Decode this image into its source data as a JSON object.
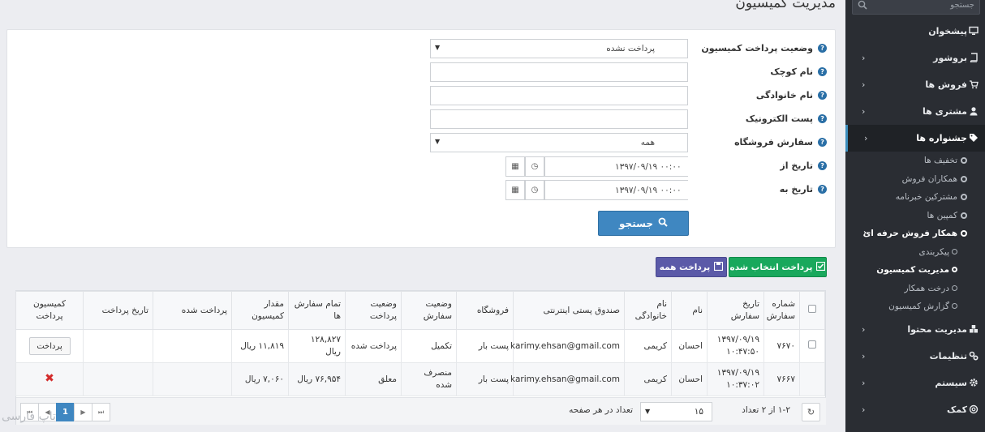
{
  "page": {
    "title": "مدیریت کمیسیون"
  },
  "sidebar": {
    "search_placeholder": "جستجو",
    "items": [
      {
        "label": "پیشخوان"
      },
      {
        "label": "بروشور"
      },
      {
        "label": "فروش ها"
      },
      {
        "label": "مشتری ها"
      },
      {
        "label": "جشنواره ها"
      }
    ],
    "festival_sub": [
      {
        "label": "تخفیف ها"
      },
      {
        "label": "همکاران فروش"
      },
      {
        "label": "مشترکین خبرنامه"
      },
      {
        "label": "کمپین ها"
      },
      {
        "label": "همکار فروش حرفه ای"
      }
    ],
    "affiliate_sub": [
      {
        "label": "پیکربندی"
      },
      {
        "label": "مدیریت کمیسیون"
      },
      {
        "label": "درخت همکار"
      },
      {
        "label": "گزارش کمیسیون"
      }
    ],
    "bottom_items": [
      {
        "label": "مدیریت محتوا"
      },
      {
        "label": "تنظیمات"
      },
      {
        "label": "سیستم"
      },
      {
        "label": "کمک"
      }
    ]
  },
  "filter": {
    "status_label": "وضعیت پرداخت کمیسیون",
    "status_value": "پرداخت نشده",
    "firstname_label": "نام کوچک",
    "lastname_label": "نام خانوادگی",
    "email_label": "پست الکترونیک",
    "store_order_label": "سفارش فروشگاه",
    "store_order_value": "همه",
    "date_from_label": "تاریخ از",
    "date_from_value": "۱۳۹۷/۰۹/۱۹ ۰۰:۰۰",
    "date_to_label": "تاریخ به",
    "date_to_value": "۱۳۹۷/۰۹/۱۹ ۰۰:۰۰",
    "search_label": "جستجو"
  },
  "actions": {
    "pay_selected": "پرداخت انتخاب شده",
    "pay_all": "پرداخت همه"
  },
  "table": {
    "headers": {
      "order_no": "شماره سفارش",
      "order_date": "تاریخ سفارش",
      "firstname": "نام",
      "lastname": "نام خانوادگی",
      "email": "صندوق پستی اینترنتی",
      "store": "فروشگاه",
      "order_status": "وضعیت سفارش",
      "pay_status": "وضعیت پرداخت",
      "order_total": "تمام سفارش ها",
      "commission": "مقدار کمیسیون",
      "paid": "پرداخت شده",
      "pay_date": "تاریخ پرداخت",
      "commission_pay": "کمیسیون پرداخت"
    },
    "rows": [
      {
        "order_no": "۷۶۷۰",
        "order_date": "۱۳۹۷/۰۹/۱۹ ۱۰:۴۷:۵۰",
        "firstname": "احسان",
        "lastname": "کریمی",
        "email": "karimy.ehsan@gmail.com",
        "store": "پست بار",
        "order_status": "تکمیل",
        "pay_status": "پرداخت شده",
        "order_total": "۱۲۸,۸۲۷ ریال",
        "commission": "۱۱,۸۱۹ ریال",
        "paid": "",
        "pay_date": "",
        "action": "پرداخت"
      },
      {
        "order_no": "۷۶۶۷",
        "order_date": "۱۳۹۷/۰۹/۱۹ ۱۰:۳۷:۰۲",
        "firstname": "احسان",
        "lastname": "کریمی",
        "email": "karimy.ehsan@gmail.com",
        "store": "پست بار",
        "order_status": "منصرف شده",
        "pay_status": "معلق",
        "order_total": "۷۶,۹۵۴ ریال",
        "commission": "۷,۰۶۰ ریال",
        "paid": "",
        "pay_date": "",
        "action": ""
      }
    ]
  },
  "pager": {
    "info": "۱-۲ از ۲ تعداد",
    "page_size": "۱۵",
    "page_size_label": "تعداد در هر صفحه",
    "current_page": "1"
  },
  "watermark": "تاپ فارسی",
  "colors": {
    "sidebar_bg": "#2a2d33",
    "primary": "#3f87c1",
    "success": "#19a85c",
    "purple": "#5b5aa8",
    "danger": "#d32b2b"
  }
}
